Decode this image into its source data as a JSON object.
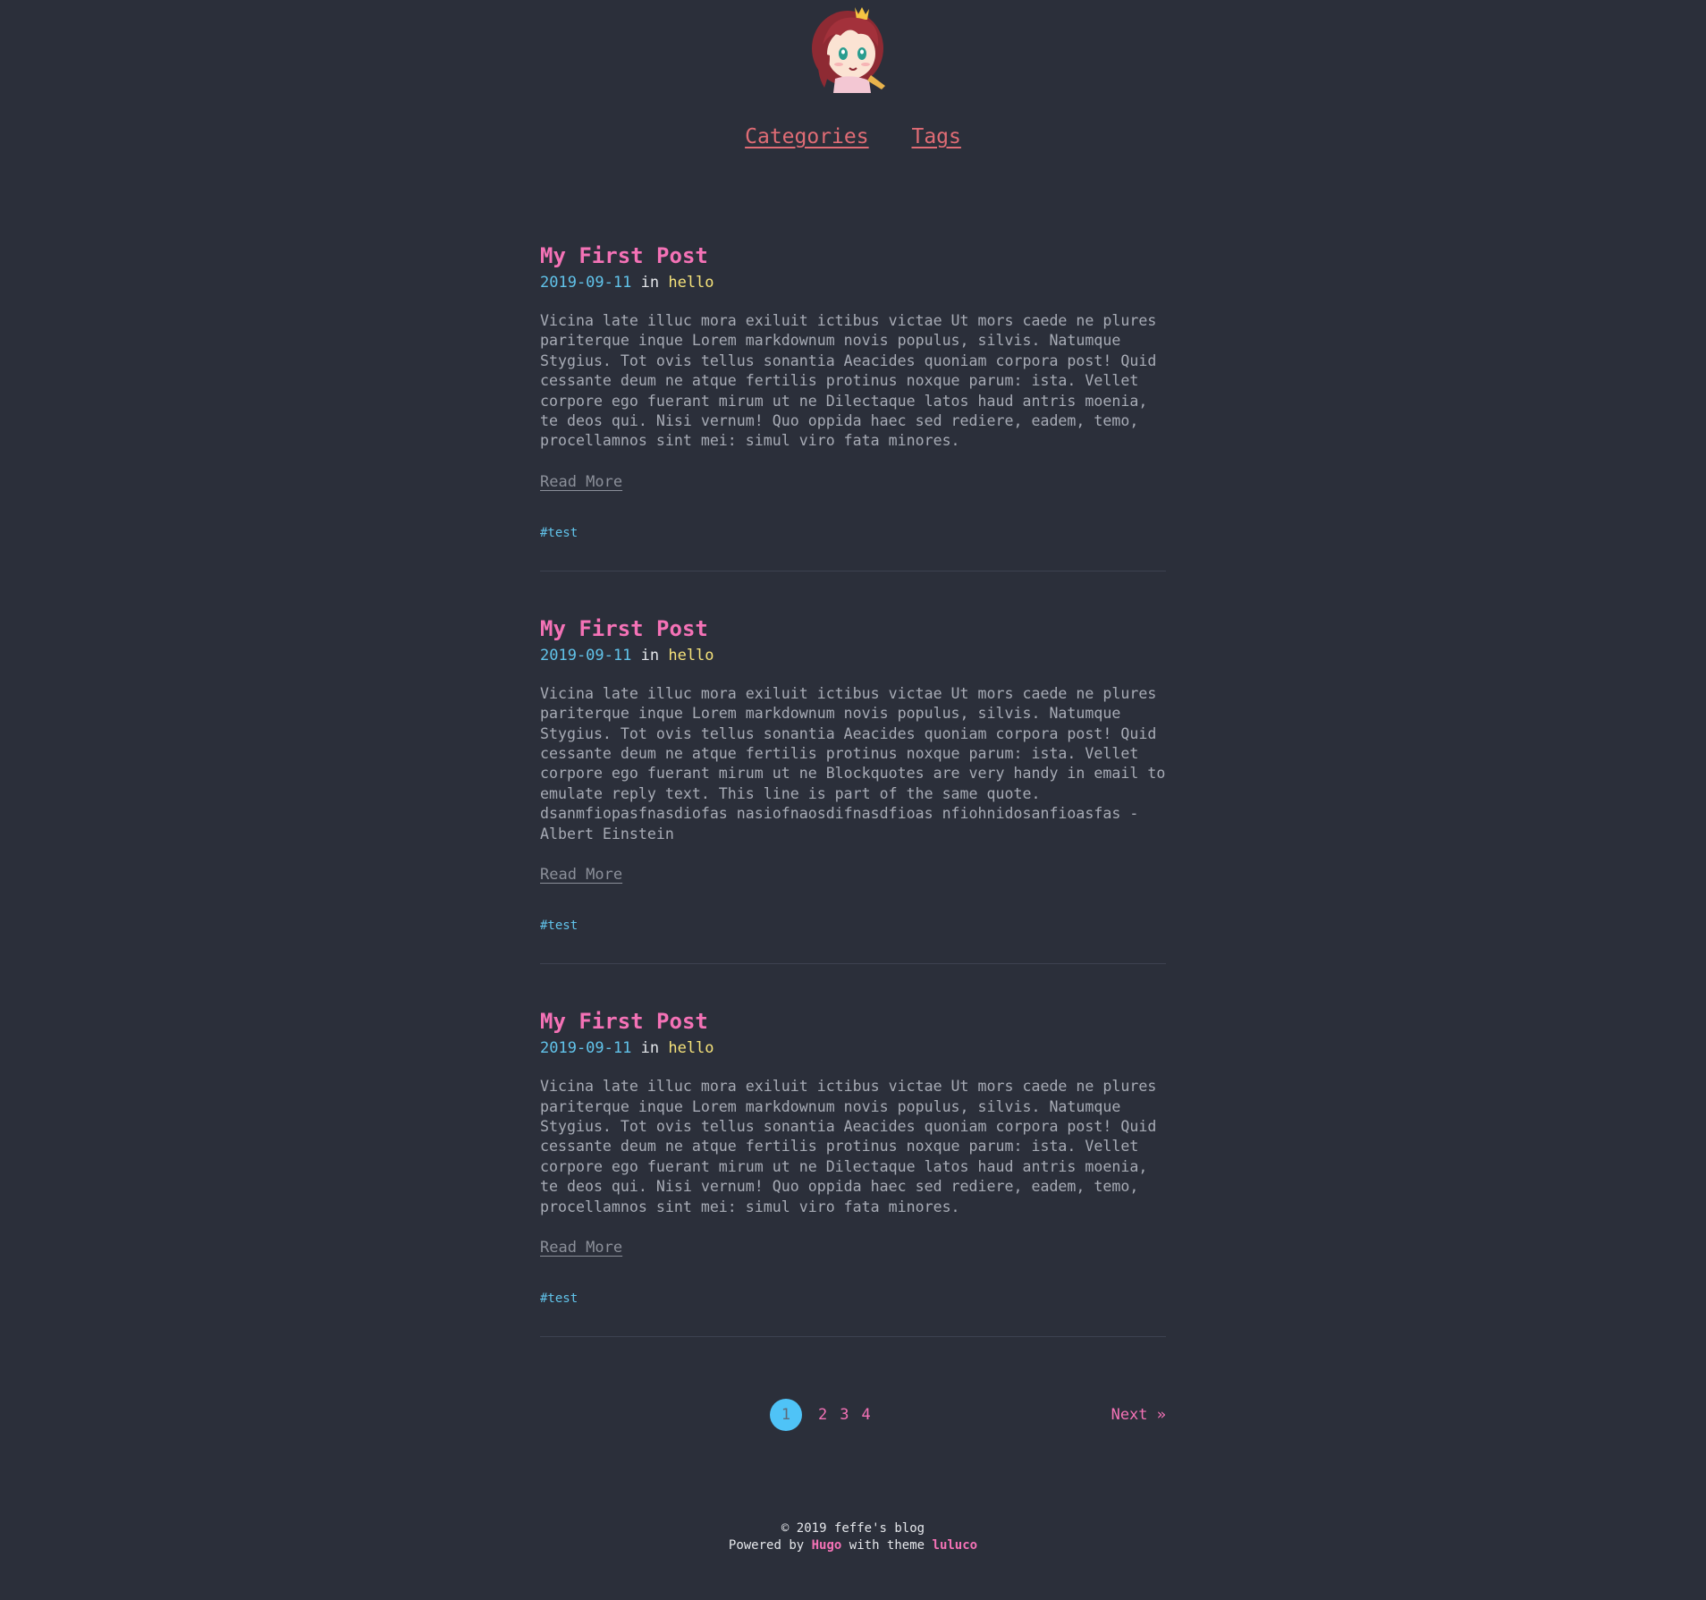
{
  "nav": {
    "items": [
      {
        "label": "Categories"
      },
      {
        "label": "Tags"
      }
    ]
  },
  "posts": [
    {
      "title": "My First Post",
      "date": "2019-09-11",
      "in_label": "in",
      "category": "hello",
      "summary": "Vicina late illuc mora exiluit ictibus victae Ut mors caede ne plures\npariterque inque Lorem markdownum novis populus, silvis. Natumque\nStygius. Tot ovis tellus sonantia Aeacides quoniam corpora post! Quid\ncessante deum ne atque fertilis protinus noxque parum: ista. Vellet\ncorpore ego fuerant mirum ut ne Dilectaque latos haud antris moenia,\nte deos qui. Nisi vernum! Quo oppida haec sed rediere, eadem, temo,\nprocellamnos sint mei: simul viro fata minores.",
      "read_more": "Read More",
      "tag": "#test"
    },
    {
      "title": "My First Post",
      "date": "2019-09-11",
      "in_label": "in",
      "category": "hello",
      "summary": "Vicina late illuc mora exiluit ictibus victae Ut mors caede ne plures\npariterque inque Lorem markdownum novis populus, silvis. Natumque\nStygius. Tot ovis tellus sonantia Aeacides quoniam corpora post! Quid\ncessante deum ne atque fertilis protinus noxque parum: ista. Vellet\ncorpore ego fuerant mirum ut ne Blockquotes are very handy in email to\nemulate reply text. This line is part of the same quote.\ndsanmfiopasfnasdiofas nasiofnaosdifnasdfioas nfiohnidosanfioasfas -\nAlbert Einstein",
      "read_more": "Read More",
      "tag": "#test"
    },
    {
      "title": "My First Post",
      "date": "2019-09-11",
      "in_label": "in",
      "category": "hello",
      "summary": "Vicina late illuc mora exiluit ictibus victae Ut mors caede ne plures\npariterque inque Lorem markdownum novis populus, silvis. Natumque\nStygius. Tot ovis tellus sonantia Aeacides quoniam corpora post! Quid\ncessante deum ne atque fertilis protinus noxque parum: ista. Vellet\ncorpore ego fuerant mirum ut ne Dilectaque latos haud antris moenia,\nte deos qui. Nisi vernum! Quo oppida haec sed rediere, eadem, temo,\nprocellamnos sint mei: simul viro fata minores.",
      "read_more": "Read More",
      "tag": "#test"
    }
  ],
  "pagination": {
    "pages": [
      "1",
      "2",
      "3",
      "4"
    ],
    "current": "1",
    "next_label": "Next »"
  },
  "footer": {
    "copyright": "© 2019 feffe's blog",
    "powered_by": "Powered by",
    "engine": "Hugo",
    "with_theme": "with theme",
    "theme": "luluco"
  },
  "colors": {
    "background": "#2b2f3a",
    "accent_pink": "#f472b6",
    "accent_blue": "#61c3ea",
    "accent_yellow": "#f5e27a",
    "nav_red": "#e06c75"
  },
  "avatar": {
    "icon": "anime-girl-avatar-icon"
  }
}
